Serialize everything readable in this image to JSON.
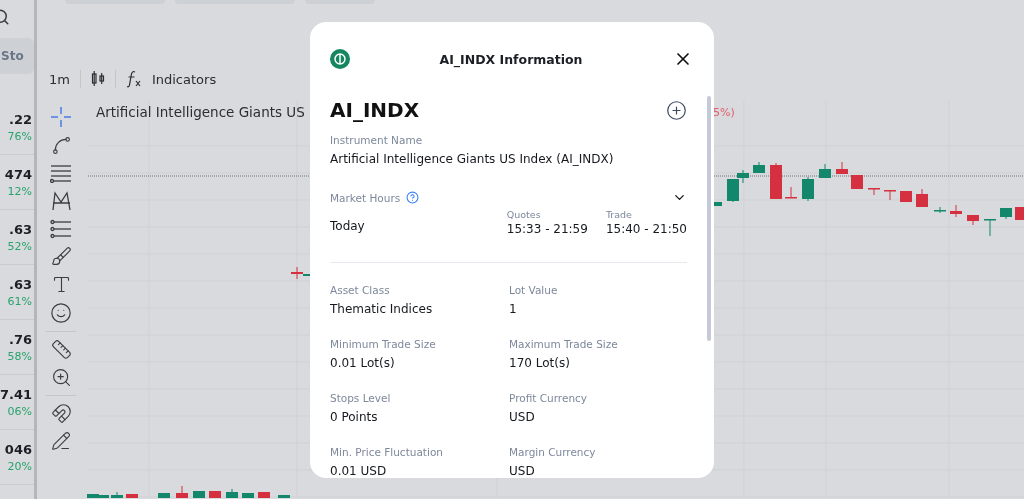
{
  "app": {
    "search_pill": "Sto",
    "watchlist": [
      {
        "price": ".22",
        "change": "76%"
      },
      {
        "price": "474",
        "change": "12%"
      },
      {
        "price": ".63",
        "change": "52%"
      },
      {
        "price": ".63",
        "change": "61%"
      },
      {
        "price": ".76",
        "change": "58%"
      },
      {
        "price": "7.41",
        "change": "06%"
      },
      {
        "price": "046",
        "change": "20%"
      }
    ],
    "timeframe": "1m",
    "indicators": "Indicators",
    "chart_title": "Artificial Intelligence Giants US",
    "chart_change": "5%)"
  },
  "modal": {
    "title": "AI_INDX Information",
    "symbol": "AI_INDX",
    "instrument_label": "Instrument Name",
    "instrument_name": "Artificial Intelligence Giants US Index (AI_INDX)",
    "market_hours": {
      "label": "Market Hours",
      "day": "Today",
      "sessions": [
        {
          "label": "Quotes",
          "hours": "15:33 - 21:59"
        },
        {
          "label": "Trade",
          "hours": "15:40 - 21:50"
        }
      ]
    },
    "fields": [
      {
        "label": "Asset Class",
        "value": "Thematic Indices"
      },
      {
        "label": "Lot Value",
        "value": "1"
      },
      {
        "label": "Minimum Trade Size",
        "value": "0.01 Lot(s)"
      },
      {
        "label": "Maximum Trade Size",
        "value": "170 Lot(s)"
      },
      {
        "label": "Stops Level",
        "value": "0 Points"
      },
      {
        "label": "Profit Currency",
        "value": "USD"
      },
      {
        "label": "Min. Price Fluctuation",
        "value": "0.01 USD"
      },
      {
        "label": "Margin Currency",
        "value": "USD"
      }
    ]
  }
}
